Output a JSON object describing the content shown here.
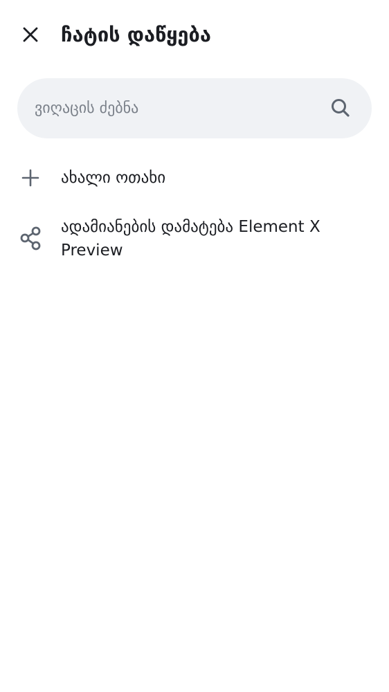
{
  "header": {
    "close_icon": "close-icon",
    "title": "ჩატის დაწყება"
  },
  "search": {
    "placeholder": "ვიღაცის ძებნა",
    "value": "",
    "icon": "search-icon"
  },
  "menu": {
    "items": [
      {
        "icon": "plus-icon",
        "label": "ახალი ოთახი"
      },
      {
        "icon": "share-icon",
        "label": "ადამიანების დამატება Element X Preview"
      }
    ]
  },
  "colors": {
    "background": "#ffffff",
    "text": "#1b1d22",
    "icon": "#5d6570",
    "search_bg": "#f0f2f5",
    "placeholder": "#7a8089"
  }
}
